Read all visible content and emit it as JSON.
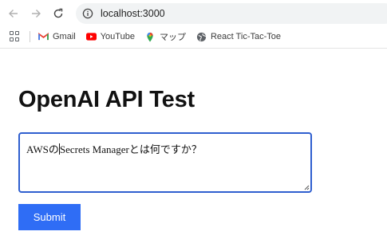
{
  "browser": {
    "url": "localhost:3000",
    "icons": [
      "back-icon",
      "forward-icon",
      "reload-icon",
      "site-info-icon"
    ]
  },
  "bookmarks": [
    {
      "label": "Gmail",
      "icon": "gmail-icon"
    },
    {
      "label": "YouTube",
      "icon": "youtube-icon"
    },
    {
      "label": "マップ",
      "icon": "maps-icon"
    },
    {
      "label": "React Tic-Tac-Toe",
      "icon": "globe-icon"
    }
  ],
  "page": {
    "title": "OpenAI API Test",
    "prompt_before_caret": "AWSの",
    "prompt_after_caret": "Secrets Managerとは何ですか？",
    "submit_label": "Submit"
  },
  "colors": {
    "accent": "#2f6df5",
    "focus_border": "#2f5fcf",
    "omnibox_bg": "#f1f3f4"
  }
}
